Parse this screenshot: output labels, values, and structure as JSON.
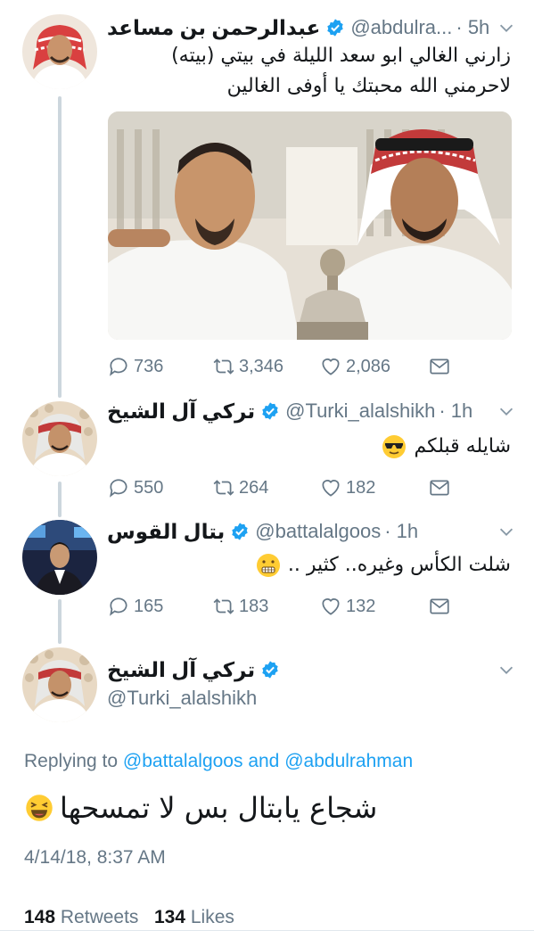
{
  "tweets": [
    {
      "name": "عبدالرحمن بن مساعد",
      "handle": "@abdulra...",
      "time": "· 5h",
      "text": "زارني الغالي ابو سعد الليلة في بيتي (بيته) لاحرمني الله محبتك يا أوفى الغالين",
      "replies": "736",
      "retweets": "3,346",
      "likes": "2,086"
    },
    {
      "name": "تركي آل الشيخ",
      "handle": "@Turki_alalshikh",
      "time": "· 1h",
      "text": "شايله قبلكم",
      "replies": "550",
      "retweets": "264",
      "likes": "182"
    },
    {
      "name": "بتال القوس",
      "handle": "@battalalgoos",
      "time": "· 1h",
      "text": "شلت الكأس وغيره.. كثير ..",
      "replies": "165",
      "retweets": "183",
      "likes": "132"
    }
  ],
  "focused": {
    "name": "تركي آل الشيخ",
    "handle": "@Turki_alalshikh",
    "replying_prefix": "Replying to",
    "replying_user1": "@battalalgoos",
    "replying_and": "and",
    "replying_user2": "@abdulrahman",
    "text": "شجاع يابتال بس لا تمسحها",
    "timestamp": "4/14/18, 8:37 AM",
    "retweets_count": "148",
    "retweets_label": "Retweets",
    "likes_count": "134",
    "likes_label": "Likes"
  },
  "colors": {
    "accent": "#1da1f2",
    "secondary_text": "#657786",
    "thread_line": "#ccd6dd"
  },
  "icons": [
    "verified-badge-icon",
    "chevron-down-icon",
    "reply-icon",
    "retweet-icon",
    "like-icon",
    "dm-icon",
    "sunglasses-emoji-icon",
    "grimace-emoji-icon",
    "laughing-emoji-icon"
  ]
}
